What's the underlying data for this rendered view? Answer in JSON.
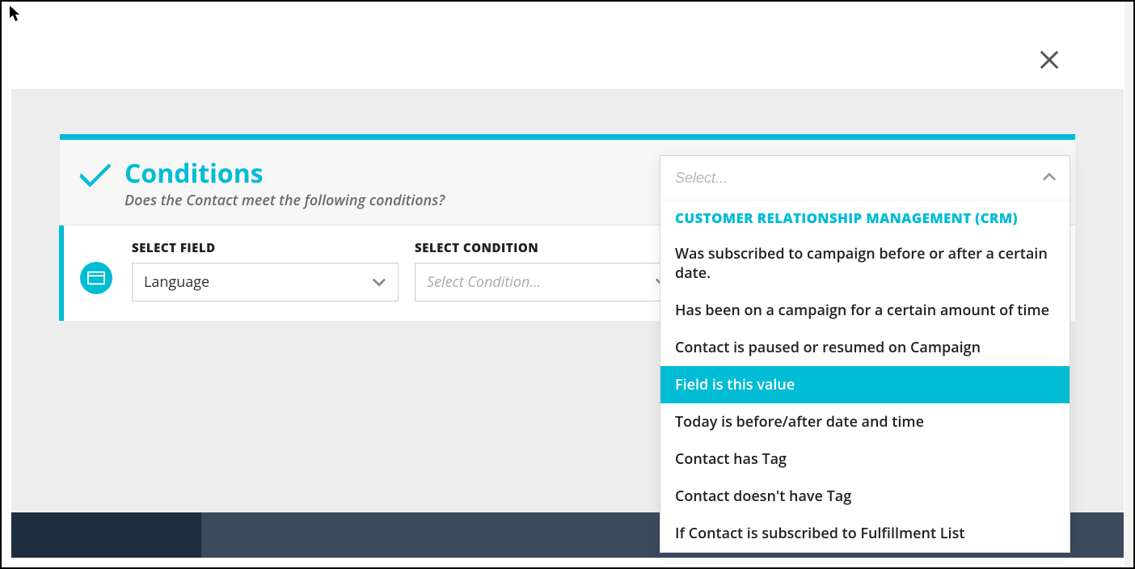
{
  "header": {
    "title": "Conditions",
    "subtitle": "Does the Contact meet the following conditions?"
  },
  "row": {
    "field_label": "SELECT FIELD",
    "field_value": "Language",
    "condition_label": "SELECT CONDITION",
    "condition_placeholder": "Select Condition..."
  },
  "dropdown": {
    "search_placeholder": "Select...",
    "group_label": "CUSTOMER RELATIONSHIP MANAGEMENT (CRM)",
    "items": [
      "Was subscribed to campaign before or after a certain date.",
      "Has been on a campaign for a certain amount of time",
      "Contact is paused or resumed on Campaign",
      "Field is this value",
      "Today is before/after date and time",
      "Contact has Tag",
      "Contact doesn't have Tag",
      "If Contact is subscribed to Fulfillment List"
    ],
    "selected_index": 3
  }
}
